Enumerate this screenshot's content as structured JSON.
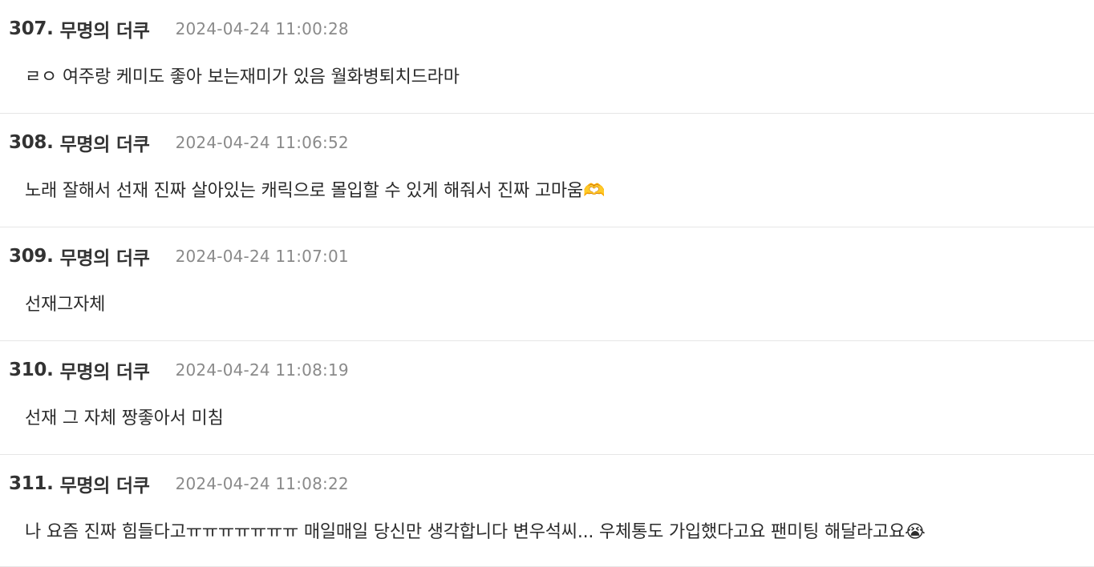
{
  "comments": [
    {
      "number": "307.",
      "author": "무명의 더쿠",
      "timestamp": "2024-04-24 11:00:28",
      "text": "ㄹㅇ 여주랑 케미도 좋아 보는재미가 있음 월화병퇴치드라마"
    },
    {
      "number": "308.",
      "author": "무명의 더쿠",
      "timestamp": "2024-04-24 11:06:52",
      "text": "노래 잘해서 선재 진짜 살아있는 캐릭으로 몰입할 수 있게 해줘서 진짜 고마움🫶"
    },
    {
      "number": "309.",
      "author": "무명의 더쿠",
      "timestamp": "2024-04-24 11:07:01",
      "text": "선재그자체"
    },
    {
      "number": "310.",
      "author": "무명의 더쿠",
      "timestamp": "2024-04-24 11:08:19",
      "text": "선재 그 자체 짱좋아서 미침"
    },
    {
      "number": "311.",
      "author": "무명의 더쿠",
      "timestamp": "2024-04-24 11:08:22",
      "text": "나 요즘 진짜 힘들다고ㅠㅠㅠㅠㅠㅠㅠ 매일매일 당신만 생각합니다 변우석씨... 우체통도 가입했다고요 팬미팅 해달라고요😭"
    }
  ]
}
